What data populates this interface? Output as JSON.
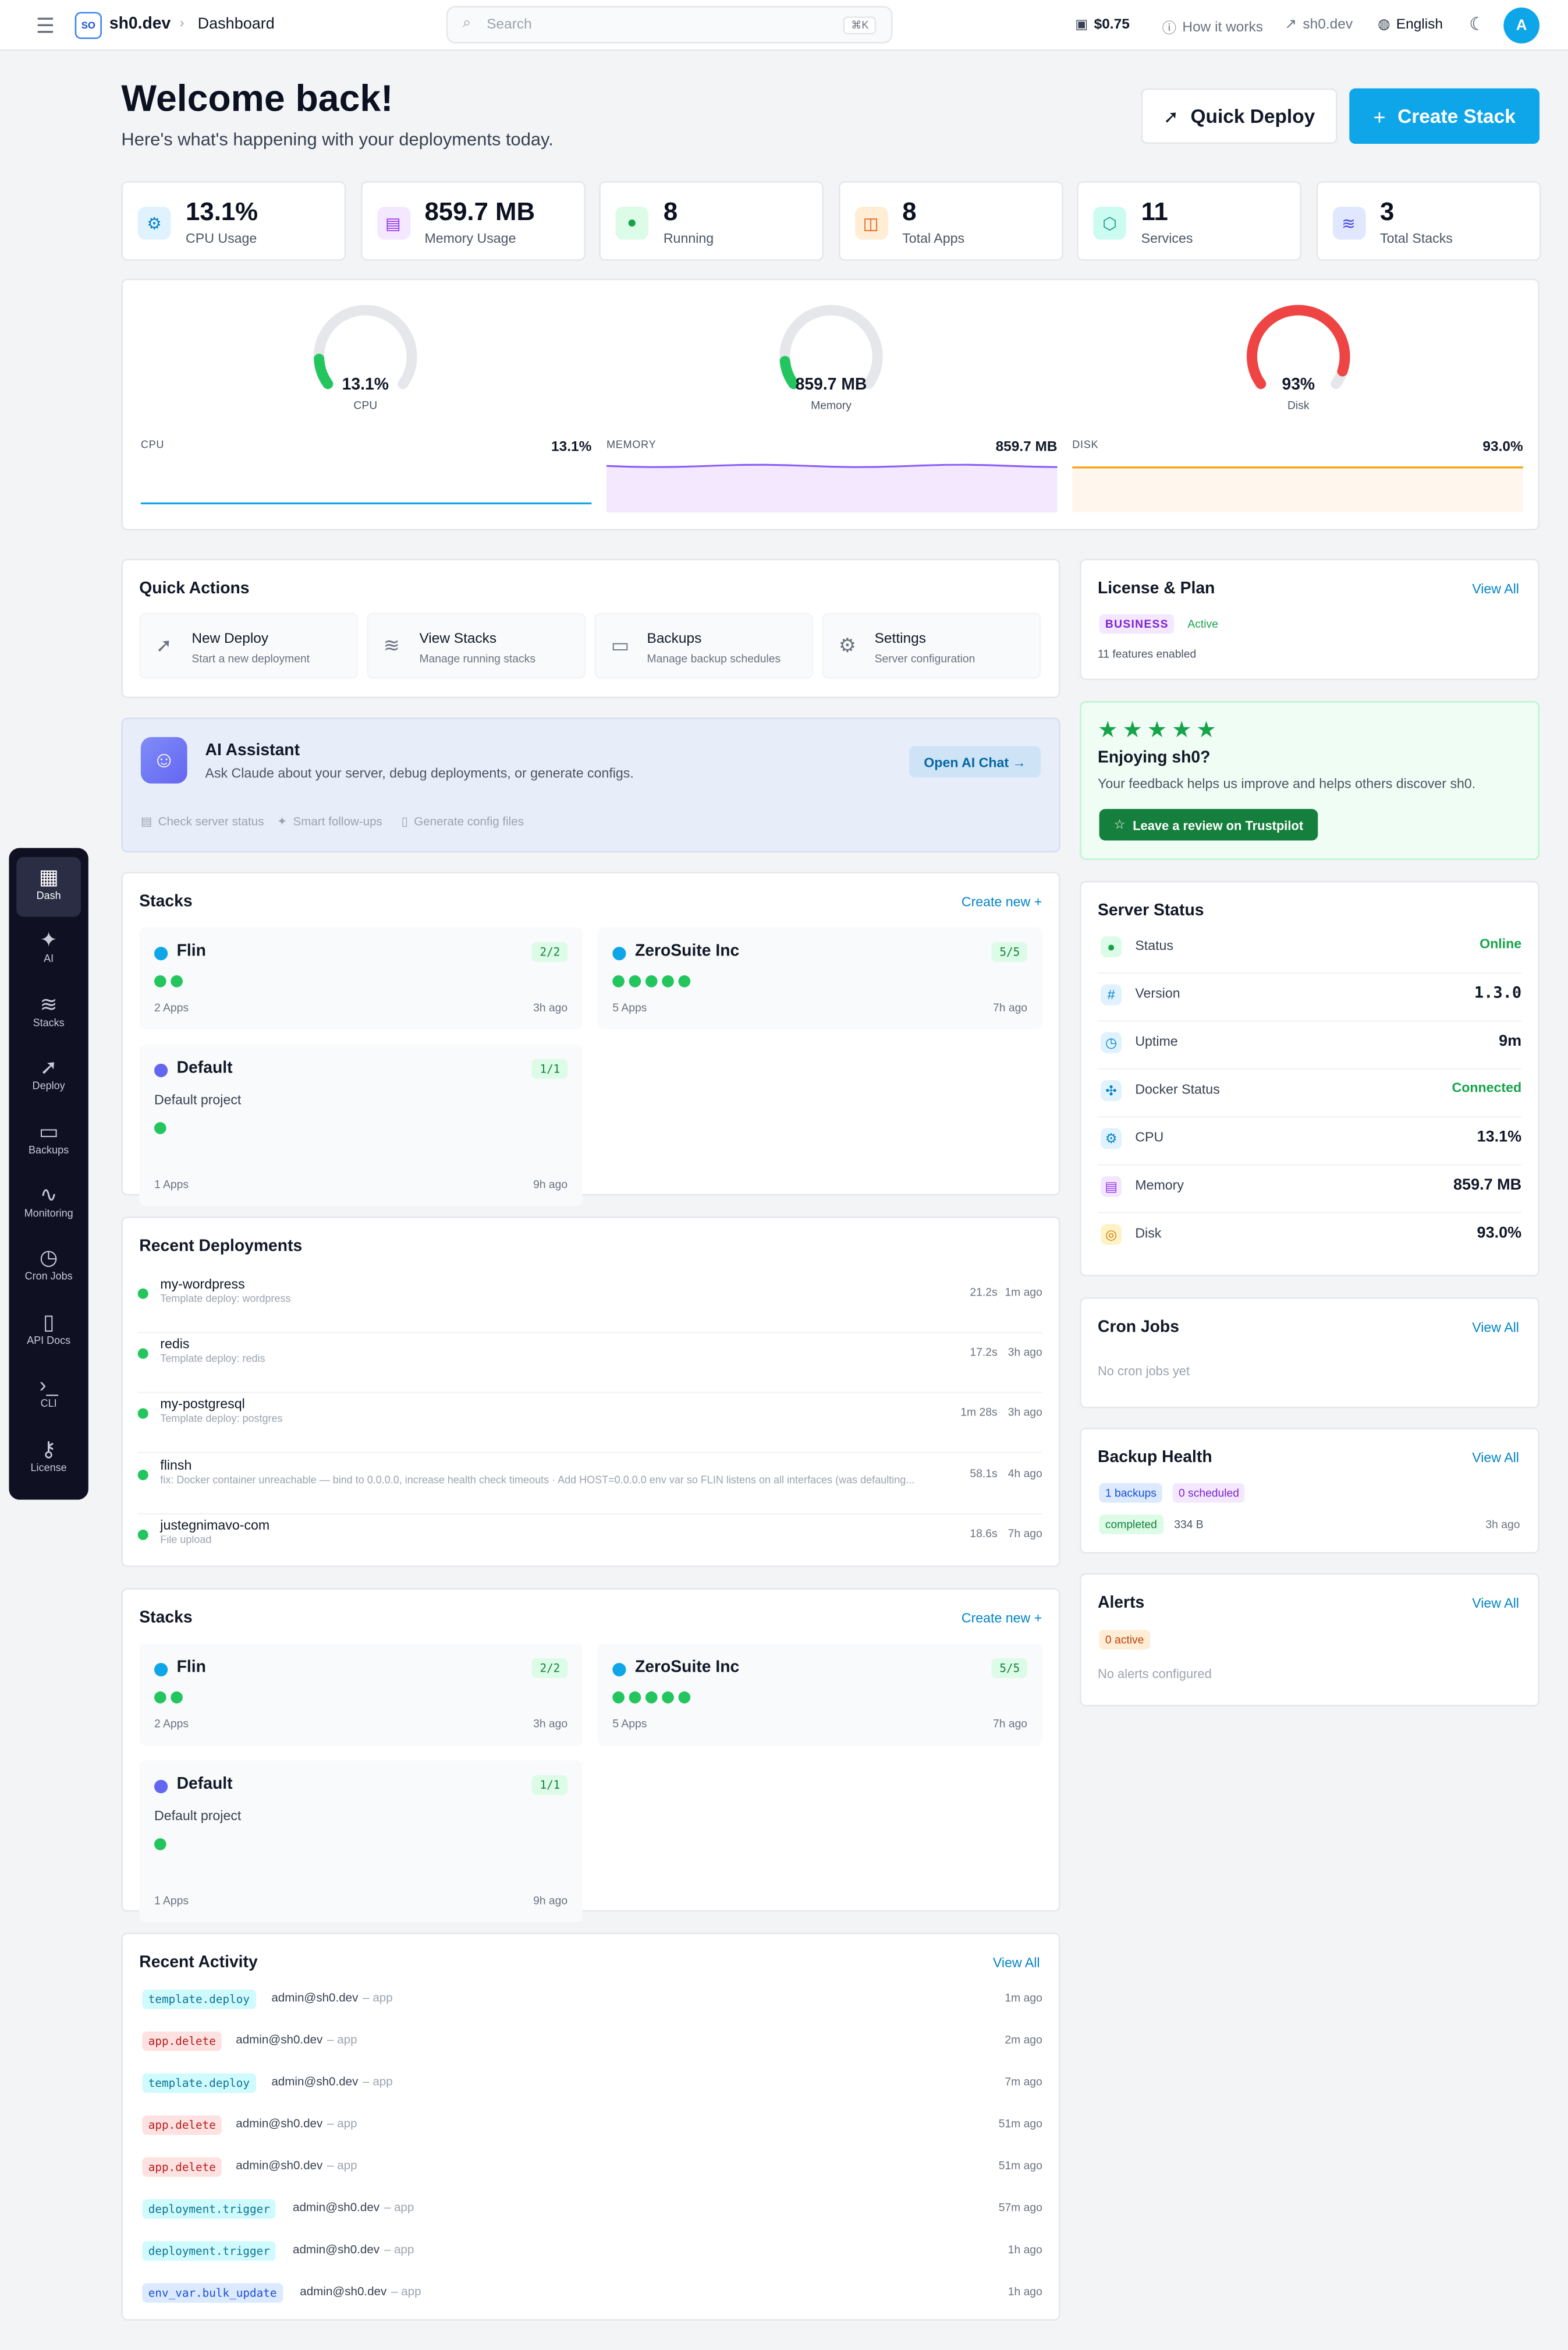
{
  "topbar": {
    "brand": "sh0.dev",
    "logo_text": "SO",
    "breadcrumb": "Dashboard",
    "search_placeholder": "Search",
    "search_shortcut": "⌘K",
    "balance": "$0.75",
    "how_it_works": "How it works",
    "site_link": "sh0.dev",
    "language": "English",
    "avatar_initial": "A"
  },
  "header": {
    "title": "Welcome back!",
    "subtitle": "Here's what's happening with your deployments today.",
    "quick_deploy": "Quick Deploy",
    "create_stack": "Create Stack"
  },
  "stats": [
    {
      "value": "13.1%",
      "label": "CPU Usage",
      "icon": "cpu-icon",
      "bg": "#e0f2fe",
      "fg": "#0284c7"
    },
    {
      "value": "859.7 MB",
      "label": "Memory Usage",
      "icon": "memory-icon",
      "bg": "#f3e8ff",
      "fg": "#9333ea"
    },
    {
      "value": "8",
      "label": "Running",
      "icon": "running-dot-icon",
      "bg": "#dcfce7",
      "fg": "#16a34a"
    },
    {
      "value": "8",
      "label": "Total Apps",
      "icon": "box-icon",
      "bg": "#ffedd5",
      "fg": "#ea580c"
    },
    {
      "value": "11",
      "label": "Services",
      "icon": "cube-icon",
      "bg": "#ccfbf1",
      "fg": "#0d9488"
    },
    {
      "value": "3",
      "label": "Total Stacks",
      "icon": "layers-icon",
      "bg": "#e0e7ff",
      "fg": "#4f46e5"
    }
  ],
  "gauges": [
    {
      "value": "13.1%",
      "label": "CPU",
      "fraction": 0.131,
      "color": "#22c55e"
    },
    {
      "value": "859.7 MB",
      "label": "Memory",
      "fraction": 0.12,
      "color": "#22c55e"
    },
    {
      "value": "93%",
      "label": "Disk",
      "fraction": 0.93,
      "color": "#ef4444"
    }
  ],
  "minicharts": [
    {
      "label": "CPU",
      "value": "13.1%",
      "color": "#0ea5e9",
      "fill": "none"
    },
    {
      "label": "MEMORY",
      "value": "859.7 MB",
      "color": "#8b5cf6",
      "fill": "#f3e8ff"
    },
    {
      "label": "DISK",
      "value": "93.0%",
      "color": "#f59e0b",
      "fill": "#fff7ed"
    }
  ],
  "quick_actions": {
    "title": "Quick Actions",
    "items": [
      {
        "title": "New Deploy",
        "desc": "Start a new deployment",
        "icon": "rocket-icon"
      },
      {
        "title": "View Stacks",
        "desc": "Manage running stacks",
        "icon": "layers-icon"
      },
      {
        "title": "Backups",
        "desc": "Manage backup schedules",
        "icon": "archive-icon"
      },
      {
        "title": "Settings",
        "desc": "Server configuration",
        "icon": "gear-icon"
      }
    ]
  },
  "ai": {
    "title": "AI Assistant",
    "desc": "Ask Claude about your server, debug deployments, or generate configs.",
    "button": "Open AI Chat →",
    "features": [
      "Check server status",
      "Smart follow-ups",
      "Generate config files"
    ]
  },
  "license": {
    "title": "License & Plan",
    "link": "View All",
    "plan": "BUSINESS",
    "status": "Active",
    "features": "11 features enabled"
  },
  "feedback": {
    "stars": "★★★★★",
    "title": "Enjoying sh0?",
    "desc": "Your feedback helps us improve and helps others discover sh0.",
    "button": "Leave a review on Trustpilot"
  },
  "stacks_section": {
    "title": "Stacks",
    "link": "Create new +",
    "items": [
      {
        "name": "Flin",
        "badge": "2/2",
        "dots": 2,
        "apps": "2 Apps",
        "ago": "3h ago",
        "color": "#0ea5e9",
        "desc": ""
      },
      {
        "name": "ZeroSuite Inc",
        "badge": "5/5",
        "dots": 5,
        "apps": "5 Apps",
        "ago": "7h ago",
        "color": "#0ea5e9",
        "desc": ""
      },
      {
        "name": "Default",
        "badge": "1/1",
        "dots": 1,
        "apps": "1 Apps",
        "ago": "9h ago",
        "color": "#6366f1",
        "desc": "Default project"
      }
    ]
  },
  "deployments": {
    "title": "Recent Deployments",
    "items": [
      {
        "name": "my-wordpress",
        "msg": "Template deploy: wordpress",
        "dur": "21.2s",
        "ago": "1m ago"
      },
      {
        "name": "redis",
        "msg": "Template deploy: redis",
        "dur": "17.2s",
        "ago": "3h ago"
      },
      {
        "name": "my-postgresql",
        "msg": "Template deploy: postgres",
        "dur": "1m 28s",
        "ago": "3h ago"
      },
      {
        "name": "flinsh",
        "msg": "fix: Docker container unreachable — bind to 0.0.0.0, increase health check timeouts · Add HOST=0.0.0.0 env var so FLIN listens on all interfaces (was defaulting...",
        "dur": "58.1s",
        "ago": "4h ago"
      },
      {
        "name": "justegnimavo-com",
        "msg": "File upload",
        "dur": "18.6s",
        "ago": "7h ago"
      }
    ]
  },
  "activity": {
    "title": "Recent Activity",
    "link": "View All",
    "items": [
      {
        "tag": "template.deploy",
        "kind": "cyan",
        "who": "admin@sh0.dev",
        "what": "– app",
        "ago": "1m ago"
      },
      {
        "tag": "app.delete",
        "kind": "red",
        "who": "admin@sh0.dev",
        "what": "– app",
        "ago": "2m ago"
      },
      {
        "tag": "template.deploy",
        "kind": "cyan",
        "who": "admin@sh0.dev",
        "what": "– app",
        "ago": "7m ago"
      },
      {
        "tag": "app.delete",
        "kind": "red",
        "who": "admin@sh0.dev",
        "what": "– app",
        "ago": "51m ago"
      },
      {
        "tag": "app.delete",
        "kind": "red",
        "who": "admin@sh0.dev",
        "what": "– app",
        "ago": "51m ago"
      },
      {
        "tag": "deployment.trigger",
        "kind": "cyan",
        "who": "admin@sh0.dev",
        "what": "– app",
        "ago": "57m ago"
      },
      {
        "tag": "deployment.trigger",
        "kind": "cyan",
        "who": "admin@sh0.dev",
        "what": "– app",
        "ago": "1h ago"
      },
      {
        "tag": "env_var.bulk_update",
        "kind": "blue",
        "who": "admin@sh0.dev",
        "what": "– app",
        "ago": "1h ago"
      }
    ]
  },
  "server": {
    "title": "Server Status",
    "rows": [
      {
        "label": "Status",
        "value": "Online",
        "icon": "status-dot-icon",
        "color": "#16a34a"
      },
      {
        "label": "Version",
        "value": "1.3.0",
        "icon": "hash-icon",
        "color": "#111827"
      },
      {
        "label": "Uptime",
        "value": "9m",
        "icon": "clock-icon",
        "color": "#111827"
      },
      {
        "label": "Docker Status",
        "value": "Connected",
        "icon": "docker-icon",
        "color": "#16a34a"
      },
      {
        "label": "CPU",
        "value": "13.1%",
        "icon": "cpu-icon",
        "color": "#111827"
      },
      {
        "label": "Memory",
        "value": "859.7 MB",
        "icon": "memory-icon",
        "color": "#111827"
      },
      {
        "label": "Disk",
        "value": "93.0%",
        "icon": "database-icon",
        "color": "#111827"
      }
    ]
  },
  "cron": {
    "title": "Cron Jobs",
    "link": "View All",
    "empty": "No cron jobs yet"
  },
  "backup": {
    "title": "Backup Health",
    "link": "View All",
    "backups": "1 backups",
    "scheduled": "0 scheduled",
    "status": "completed",
    "size": "334 B",
    "ago": "3h ago"
  },
  "alerts": {
    "title": "Alerts",
    "link": "View All",
    "active": "0 active",
    "empty": "No alerts configured"
  },
  "sidebar": {
    "items": [
      {
        "label": "Dash",
        "icon": "grid-icon"
      },
      {
        "label": "AI",
        "icon": "sparkle-icon"
      },
      {
        "label": "Stacks",
        "icon": "layers-icon"
      },
      {
        "label": "Deploy",
        "icon": "rocket-icon"
      },
      {
        "label": "Backups",
        "icon": "archive-icon"
      },
      {
        "label": "Monitoring",
        "icon": "pulse-icon"
      },
      {
        "label": "Cron Jobs",
        "icon": "clock-icon"
      },
      {
        "label": "API Docs",
        "icon": "book-icon"
      },
      {
        "label": "CLI",
        "icon": "terminal-icon"
      },
      {
        "label": "License",
        "icon": "key-icon"
      }
    ]
  }
}
